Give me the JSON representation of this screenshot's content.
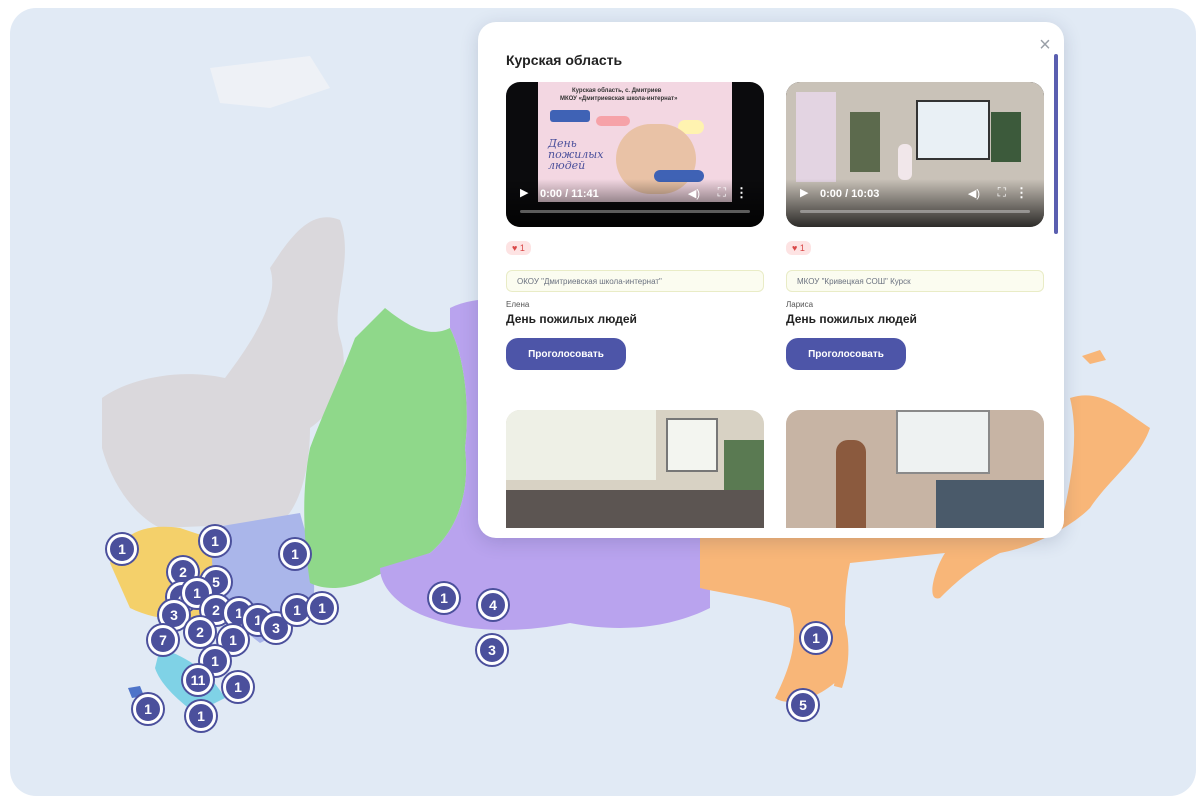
{
  "modal": {
    "title": "Курская область",
    "close_icon": "close-icon"
  },
  "cards": [
    {
      "video_title_line1": "Курская область, с. Дмитриев",
      "video_title_line2": "МКОУ «Дмитриевская школа-интернат»",
      "video_slide_text": "День пожилых людей",
      "time": "0:00 / 11:41",
      "likes": "♥ 1",
      "school": "ОКОУ \"Дмитриевская школа-интернат\"",
      "author": "Елена",
      "title": "День пожилых людей",
      "vote_label": "Проголосовать"
    },
    {
      "time": "0:00 / 10:03",
      "likes": "♥ 1",
      "school": "МКОУ \"Кривецкая СОШ\" Курск",
      "author": "Лариса",
      "title": "День пожилых людей",
      "vote_label": "Проголосовать"
    }
  ],
  "map_clusters": [
    {
      "label": "1",
      "color": "#4b509c"
    },
    {
      "label": "1",
      "color": "#4b509c"
    },
    {
      "label": "1",
      "color": "#4b509c"
    },
    {
      "label": "2",
      "color": "#4b509c"
    },
    {
      "label": "5",
      "color": "#4b509c"
    },
    {
      "label": "4",
      "color": "#4b509c"
    },
    {
      "label": "1",
      "color": "#4b509c"
    },
    {
      "label": "3",
      "color": "#4b509c"
    },
    {
      "label": "2",
      "color": "#4b509c"
    },
    {
      "label": "1",
      "color": "#4b509c"
    },
    {
      "label": "1",
      "color": "#4b509c"
    },
    {
      "label": "3",
      "color": "#4b509c"
    },
    {
      "label": "1",
      "color": "#4b509c"
    },
    {
      "label": "1",
      "color": "#4b509c"
    },
    {
      "label": "7",
      "color": "#4b509c"
    },
    {
      "label": "2",
      "color": "#4b509c"
    },
    {
      "label": "1",
      "color": "#4b509c"
    },
    {
      "label": "1",
      "color": "#4b509c"
    },
    {
      "label": "11",
      "color": "#4b509c"
    },
    {
      "label": "1",
      "color": "#4b509c"
    },
    {
      "label": "1",
      "color": "#4b509c"
    },
    {
      "label": "1",
      "color": "#4b509c"
    },
    {
      "label": "1",
      "color": "#4b509c"
    },
    {
      "label": "4",
      "color": "#4b509c"
    },
    {
      "label": "3",
      "color": "#4b509c"
    },
    {
      "label": "1",
      "color": "#4b509c"
    },
    {
      "label": "5",
      "color": "#4b509c"
    }
  ],
  "colors": {
    "map_background": "#e1eaf5",
    "cluster": "#4b509c",
    "vote_button": "#4d55a8",
    "region_yellow": "#f4d06a",
    "region_blue": "#aab6ea",
    "region_green": "#8fd88a",
    "region_violet": "#b9a3ee",
    "region_orange": "#f8b678",
    "region_grey": "#dad8dc"
  }
}
